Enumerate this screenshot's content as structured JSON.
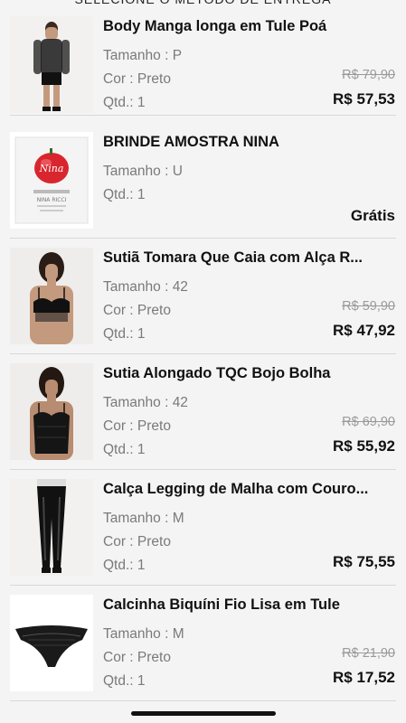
{
  "header": {
    "title": "SELECIONE O MÉTODO DE ENTREGA"
  },
  "labels": {
    "size": "Tamanho : ",
    "color": "Cor : ",
    "qty": "Qtd.: "
  },
  "items": [
    {
      "title": "Body Manga longa em Tule Poá",
      "size": "P",
      "color": "Preto",
      "qty": "1",
      "old_price": "R$ 79,90",
      "price": "R$ 57,53"
    },
    {
      "title": "BRINDE AMOSTRA NINA",
      "size": "U",
      "qty": "1",
      "price": "Grátis"
    },
    {
      "title": "Sutiã Tomara Que Caia com Alça R...",
      "size": "42",
      "color": "Preto",
      "qty": "1",
      "old_price": "R$ 59,90",
      "price": "R$ 47,92"
    },
    {
      "title": "Sutia Alongado TQC Bojo Bolha",
      "size": "42",
      "color": "Preto",
      "qty": "1",
      "old_price": "R$ 69,90",
      "price": "R$ 55,92"
    },
    {
      "title": "Calça Legging de Malha com Couro...",
      "size": "M",
      "color": "Preto",
      "qty": "1",
      "price": "R$ 75,55"
    },
    {
      "title": "Calcinha Biquíni Fio Lisa em Tule",
      "size": "M",
      "color": "Preto",
      "qty": "1",
      "old_price": "R$ 21,90",
      "price": "R$ 17,52"
    }
  ],
  "sample_box": {
    "brand_script": "Nina",
    "brand_name": "NINA RICCI"
  }
}
